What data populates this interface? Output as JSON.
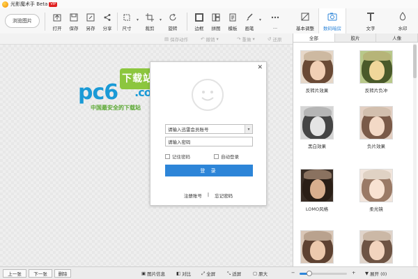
{
  "app": {
    "title": "光影魔术手 Beta",
    "badge": "VIP"
  },
  "toolbar": {
    "browse": "浏览图片",
    "tools": [
      "打开",
      "保存",
      "另存",
      "分享",
      "尺寸",
      "裁剪",
      "旋转",
      "边框",
      "拼图",
      "模板",
      "画笔",
      "..."
    ]
  },
  "subbar": {
    "save_action": "保存动作",
    "undo": "撤销",
    "redo": "重做",
    "restore": "还原"
  },
  "right_tabs": [
    "基本调整",
    "数码暗房",
    "文字",
    "水印"
  ],
  "category_tabs": [
    "全部",
    "胶片",
    "人像"
  ],
  "effects": [
    "反转片效果",
    "反转片负冲",
    "黑白效果",
    "负片效果",
    "LOMO风格",
    "柔光镜",
    "",
    ""
  ],
  "login": {
    "account_placeholder": "请输入迅雷会员账号",
    "password_placeholder": "请输入密码",
    "remember": "记住密码",
    "auto_login": "自动登录",
    "login_button": "登 录",
    "register": "注册账号",
    "divider": "|",
    "forgot": "忘记密码"
  },
  "watermark": {
    "main": "pc6",
    "site": "下载站",
    "com": ".com",
    "tagline": "中国最安全的下载站"
  },
  "bottom": {
    "prev": "上一张",
    "next": "下一张",
    "delete": "删除",
    "info": "图片信息",
    "compare": "对比",
    "fullscreen": "全屏",
    "fit": "适屏",
    "original": "原大",
    "minus": "−",
    "plus": "+",
    "zoom_level": 0.2,
    "expand": "展开 (0)"
  },
  "colors": {
    "accent": "#2d85d8",
    "login_button": "#2d85d8",
    "watermark_blue": "#1a9ad6",
    "watermark_green": "#8cc63e"
  },
  "icons": [
    "open-icon",
    "save-icon",
    "save-as-icon",
    "share-icon",
    "resize-icon",
    "crop-icon",
    "rotate-icon",
    "frame-icon",
    "collage-icon",
    "template-icon",
    "brush-icon",
    "more-icon",
    "undo-icon",
    "redo-icon",
    "restore-icon",
    "close-icon",
    "avatar-smiley-icon",
    "basic-adjust-icon",
    "darkroom-icon",
    "text-icon",
    "watermark-icon",
    "info-icon",
    "compare-icon",
    "fullscreen-icon",
    "fit-icon",
    "original-icon"
  ]
}
